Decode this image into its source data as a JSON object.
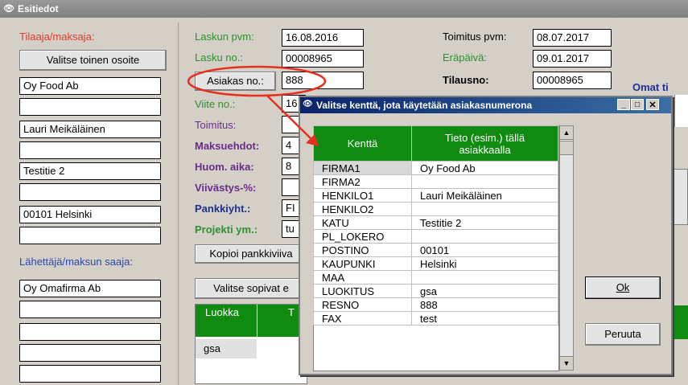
{
  "window": {
    "title": "Esitiedot"
  },
  "left": {
    "tilaaja_label": "Tilaaja/maksaja:",
    "valitse_osoite_button": "Valitse toinen osoite",
    "address_lines": [
      "Oy Food Ab",
      "",
      "Lauri Meikäläinen",
      "",
      "Testitie 2",
      "",
      "00101 Helsinki",
      ""
    ],
    "lahettaja_label": "Lähettäjä/maksun saaja:",
    "sender_lines": [
      "Oy Omafirma Ab",
      "",
      "",
      ""
    ]
  },
  "middle": {
    "laskun_pvm_label": "Laskun pvm:",
    "laskun_pvm_value": "16.08.2016",
    "lasku_no_label": "Lasku no.:",
    "lasku_no_value": "00008965",
    "asiakas_button": "Asiakas no.:",
    "asiakas_value": "888",
    "viite_label": "Viite no.:",
    "viite_value": "16",
    "toimitus_label": "Toimitus:",
    "maksuehdot_label": "Maksuehdot:",
    "maksuehdot_value": "4",
    "huom_aika_label": "Huom. aika:",
    "huom_aika_value": "8",
    "viivastys_label": "Viivästys-%:",
    "pankkiyht_label": "Pankkiyht.:",
    "pankkiyht_value": "FI",
    "projekti_label": "Projekti ym.:",
    "projekti_value": "tu",
    "kopioi_button": "Kopioi pankkiviiva",
    "valitse_sopivat_button": "Valitse sopivat e",
    "luokka_header": "Luokka",
    "luokka_header2": "T",
    "luokka_value": "gsa"
  },
  "right": {
    "toimitus_pvm_label": "Toimitus pvm:",
    "toimitus_pvm_value": "08.07.2017",
    "erapaiva_label": "Eräpäivä:",
    "erapaiva_value": "09.01.2017",
    "tilausno_label": "Tilausno:",
    "tilausno_value": "00008965",
    "omat_label": "Omat ti",
    "ok_button": "Ok",
    "peruuta_button": "Peruuta"
  },
  "dialog": {
    "title": "Valitse kenttä, jota käytetään asiakasnumerona",
    "col1_header": "Kenttä",
    "col2_header": "Tieto (esim.) tällä asiakkaalla",
    "rows": [
      {
        "field": "FIRMA1",
        "value": "Oy Food Ab"
      },
      {
        "field": "FIRMA2",
        "value": ""
      },
      {
        "field": "HENKILO1",
        "value": "Lauri Meikäläinen"
      },
      {
        "field": "HENKILO2",
        "value": ""
      },
      {
        "field": "KATU",
        "value": "Testitie 2"
      },
      {
        "field": "PL_LOKERO",
        "value": ""
      },
      {
        "field": "POSTINO",
        "value": "00101"
      },
      {
        "field": "KAUPUNKI",
        "value": "Helsinki"
      },
      {
        "field": "MAA",
        "value": ""
      },
      {
        "field": "LUOKITUS",
        "value": "gsa"
      },
      {
        "field": "RESNO",
        "value": "888"
      },
      {
        "field": "FAX",
        "value": "test"
      }
    ]
  },
  "colors": {
    "green_header": "#118a11",
    "annotation_red": "#e53020"
  }
}
